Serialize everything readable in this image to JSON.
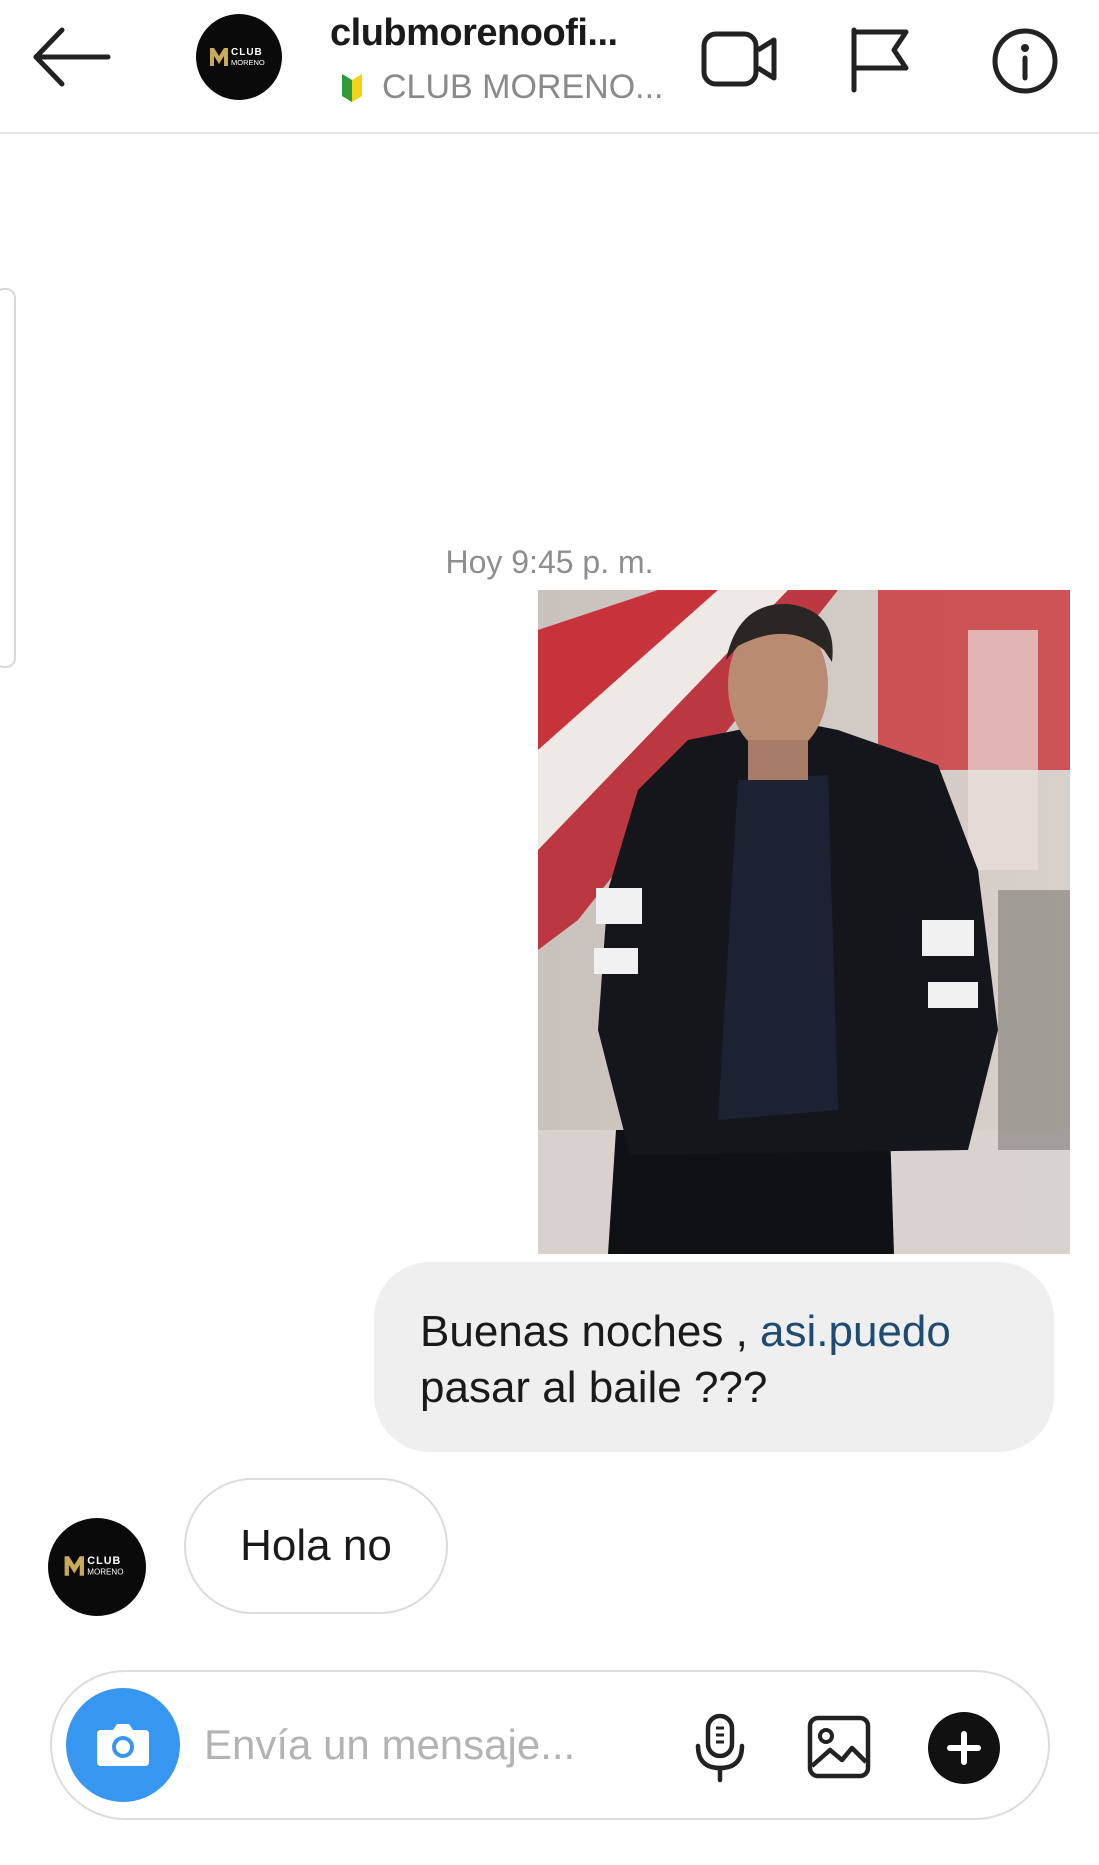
{
  "header": {
    "username": "clubmorenoofi...",
    "subtitle": "CLUB MORENO...",
    "avatar_logo": {
      "line1": "CLUB",
      "line2": "MORENO"
    },
    "icons": [
      "back-arrow-icon",
      "video-call-icon",
      "flag-icon",
      "info-icon"
    ]
  },
  "chat": {
    "timestamp": "Hoy 9:45 p. m.",
    "outgoing_message": {
      "text_part1": "Buenas noches , ",
      "link": "asi.puedo",
      "text_part2": "pasar al baile ???"
    },
    "incoming_message": {
      "text": "Hola no"
    }
  },
  "composer": {
    "placeholder": "Envía un mensaje...",
    "icons": [
      "camera-icon",
      "microphone-icon",
      "gallery-icon",
      "plus-icon"
    ]
  },
  "colors": {
    "camera_button": "#3797f0",
    "bubble_outgoing": "#efefef",
    "link_text": "#1f4b72",
    "muted_text": "#8e8e8e"
  }
}
